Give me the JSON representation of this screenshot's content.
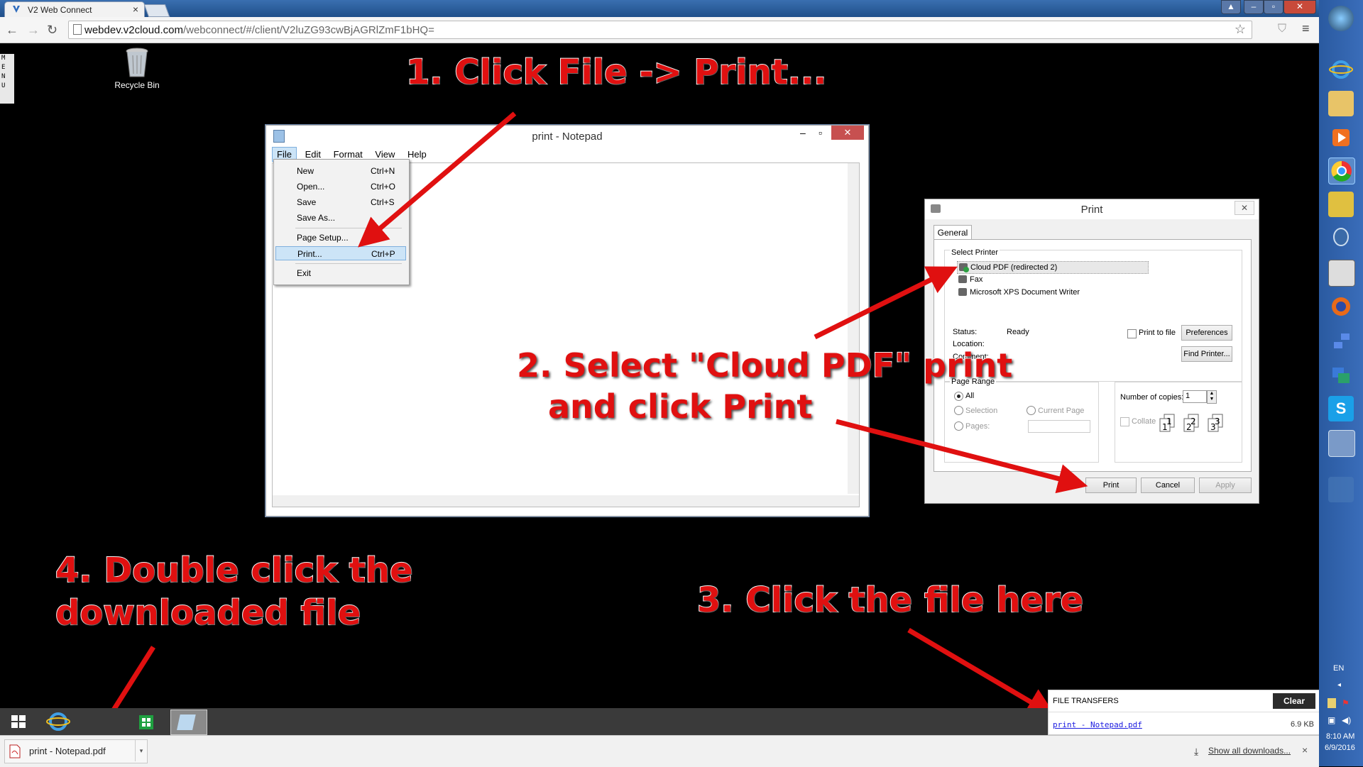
{
  "browser": {
    "tab_title": "V2 Web Connect",
    "tab_close": "×",
    "url_prefix": "webdev.v2cloud.com",
    "url_path": "/webconnect/#/client/V2luZG93cwBjAGRlZmF1bHQ=",
    "menu_handle": "M\nE\nN\nU"
  },
  "desktop": {
    "recycle_bin_label": "Recycle Bin"
  },
  "notepad": {
    "title": "print - Notepad",
    "menus": [
      "File",
      "Edit",
      "Format",
      "View",
      "Help"
    ],
    "file_menu": [
      {
        "label": "New",
        "shortcut": "Ctrl+N"
      },
      {
        "label": "Open...",
        "shortcut": "Ctrl+O"
      },
      {
        "label": "Save",
        "shortcut": "Ctrl+S"
      },
      {
        "label": "Save As...",
        "shortcut": ""
      },
      {
        "label": "Page Setup...",
        "shortcut": ""
      },
      {
        "label": "Print...",
        "shortcut": "Ctrl+P"
      },
      {
        "label": "Exit",
        "shortcut": ""
      }
    ]
  },
  "print_dialog": {
    "title": "Print",
    "tab": "General",
    "select_printer_label": "Select Printer",
    "printers": [
      "Cloud PDF (redirected 2)",
      "Fax",
      "Microsoft XPS Document Writer"
    ],
    "status_label": "Status:",
    "status_value": "Ready",
    "location_label": "Location:",
    "comment_label": "Comment:",
    "print_to_file": "Print to file",
    "preferences": "Preferences",
    "find_printer": "Find Printer...",
    "page_range_label": "Page Range",
    "all": "All",
    "selection": "Selection",
    "current_page": "Current Page",
    "pages": "Pages:",
    "copies_label": "Number of copies:",
    "copies_value": "1",
    "collate": "Collate",
    "print_btn": "Print",
    "cancel_btn": "Cancel",
    "apply_btn": "Apply"
  },
  "annotations": {
    "step1": "1. Click File -> Print...",
    "step2_line1": "2. Select \"Cloud PDF\" print",
    "step2_line2": "and click Print",
    "step3": "3. Click the file here",
    "step4_line1": "4. Double click the",
    "step4_line2": "downloaded file",
    "color": "#e01010"
  },
  "file_transfers": {
    "heading": "FILE TRANSFERS",
    "clear": "Clear",
    "file_name": "print - Notepad.pdf",
    "file_size": "6.9 KB"
  },
  "download_bar": {
    "file_name": "print - Notepad.pdf",
    "show_all": "Show all downloads...",
    "close": "×"
  },
  "tray": {
    "lang": "EN",
    "time": "8:10 AM",
    "date": "6/9/2016"
  }
}
